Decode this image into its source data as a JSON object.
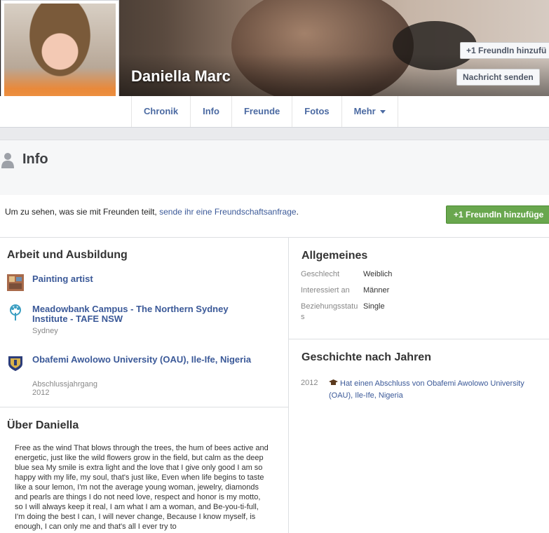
{
  "profile": {
    "name": "Daniella Marc",
    "cover_buttons": {
      "add_friend": "+1 FreundIn hinzufü",
      "message": "Nachricht senden"
    }
  },
  "nav": {
    "tabs": [
      "Chronik",
      "Info",
      "Freunde",
      "Fotos",
      "Mehr"
    ]
  },
  "info": {
    "title": "Info"
  },
  "friend_request": {
    "text_before": "Um zu sehen, was sie mit Freunden teilt, ",
    "link": "sende ihr eine Freundschaftsanfrage",
    "text_after": ".",
    "button": "+1 FreundIn hinzufüge"
  },
  "work_education": {
    "title": "Arbeit und Ausbildung",
    "items": [
      {
        "title": "Painting artist",
        "subtitle": "",
        "icon": "painting-icon"
      },
      {
        "title": "Meadowbank Campus - The Northern Sydney Institute - TAFE NSW",
        "subtitle": "Sydney",
        "icon": "tree-icon"
      },
      {
        "title": "Obafemi Awolowo University (OAU), Ile-Ife, Nigeria",
        "subtitle": "Abschlussjahrgang 2012",
        "icon": "university-crest-icon"
      }
    ]
  },
  "about": {
    "title": "Über Daniella",
    "text": "Free as the wind That blows through the trees, the hum of bees active and energetic, just like the wild flowers grow in the field, but calm as the deep blue sea My smile is extra light and the love that I give only good I am so happy with my life, my soul, that's just like, Even when life begins to taste like a sour lemon, I'm not the average young woman, jewelry, diamonds and pearls are things I do not need love, respect and honor is my motto, so I will always keep it real, I am what I am a woman, and Be-you-ti-full, I'm doing the best I can, I will never change, Because I know myself, is enough, I can only me and that's all I ever try to"
  },
  "general": {
    "title": "Allgemeines",
    "rows": [
      {
        "label": "Geschlecht",
        "value": "Weiblich"
      },
      {
        "label": "Interessiert an",
        "value": "Männer"
      },
      {
        "label": "Beziehungsstatus",
        "value": "Single"
      }
    ]
  },
  "history": {
    "title": "Geschichte nach Jahren",
    "year": "2012",
    "text": "Hat einen Abschluss von Obafemi Awolowo University (OAU), Ile-Ife, Nigeria"
  },
  "colors": {
    "link": "#3b5998",
    "add_friend_green": "#69a74e"
  }
}
